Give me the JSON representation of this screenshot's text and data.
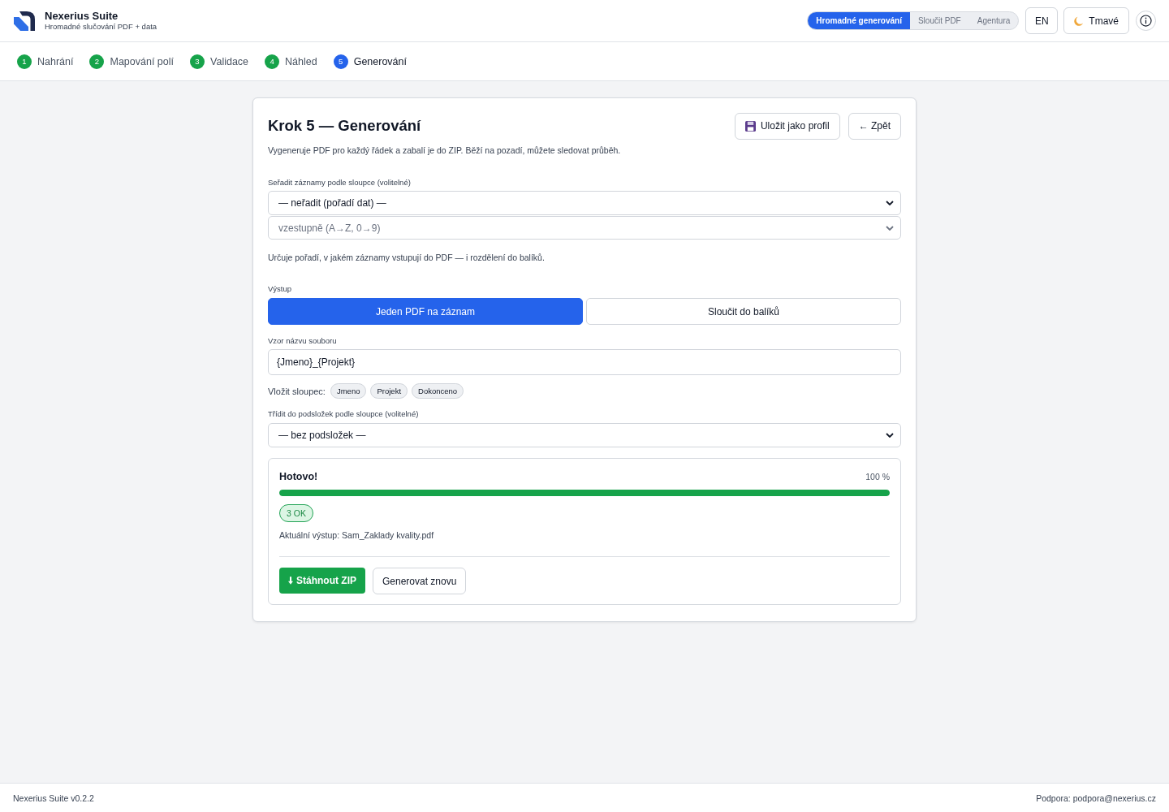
{
  "header": {
    "app_name": "Nexerius Suite",
    "subtitle": "Hromadné slučování PDF + data",
    "mode_tabs": [
      {
        "label": "Hromadné generování",
        "selected": true
      },
      {
        "label": "Sloučit PDF",
        "selected": false
      },
      {
        "label": "Agentura",
        "selected": false
      }
    ],
    "language_button": "EN",
    "theme_button": "Tmavé"
  },
  "steps": [
    {
      "number": "1",
      "label": "Nahrání",
      "completed": true,
      "selected": false
    },
    {
      "number": "2",
      "label": "Mapování polí",
      "completed": true,
      "selected": false
    },
    {
      "number": "3",
      "label": "Validace",
      "completed": true,
      "selected": false
    },
    {
      "number": "4",
      "label": "Náhled",
      "completed": true,
      "selected": false
    },
    {
      "number": "5",
      "label": "Generování",
      "completed": false,
      "selected": true
    }
  ],
  "card": {
    "title": "Krok 5 — Generování",
    "save_profile_button": "Uložit jako profil",
    "back_button": "← Zpět",
    "description": "Vygeneruje PDF pro každý řádek a zabalí je do ZIP. Běží na pozadí, můžete sledovat průběh.",
    "sort": {
      "label": "Seřadit záznamy podle sloupce (volitelné)",
      "column_select": "— neřadit (pořadí dat) —",
      "order_select": {
        "value": "vzestupně (A→Z, 0→9)",
        "disabled": true
      },
      "hint": "Určuje pořadí, v jakém záznamy vstupují do PDF — i rozdělení do balíků."
    },
    "output": {
      "label": "Výstup",
      "options": [
        {
          "label": "Jeden PDF na záznam",
          "selected": true
        },
        {
          "label": "Sloučit do balíků",
          "selected": false
        }
      ]
    },
    "filename": {
      "label": "Vzor názvu souboru",
      "value": "{Jmeno}_{Projekt}",
      "insert_label": "Vložit sloupec:",
      "columns": [
        "Jmeno",
        "Projekt",
        "Dokonceno"
      ]
    },
    "subfolder": {
      "label": "Třídit do podsložek podle sloupce (volitelné)",
      "value": "— bez podsložek —"
    },
    "progress": {
      "status": "Hotovo!",
      "percent": "100 %",
      "level": 1,
      "ok_badge": "3 OK",
      "current_output": "Aktuální výstup: Sam_Zaklady kvality.pdf",
      "download_button": "Stáhnout ZIP",
      "regenerate_button": "Generovat znovu"
    }
  },
  "footer": {
    "version": "Nexerius Suite v0.2.2",
    "support": "Podpora: podpora@nexerius.cz"
  }
}
